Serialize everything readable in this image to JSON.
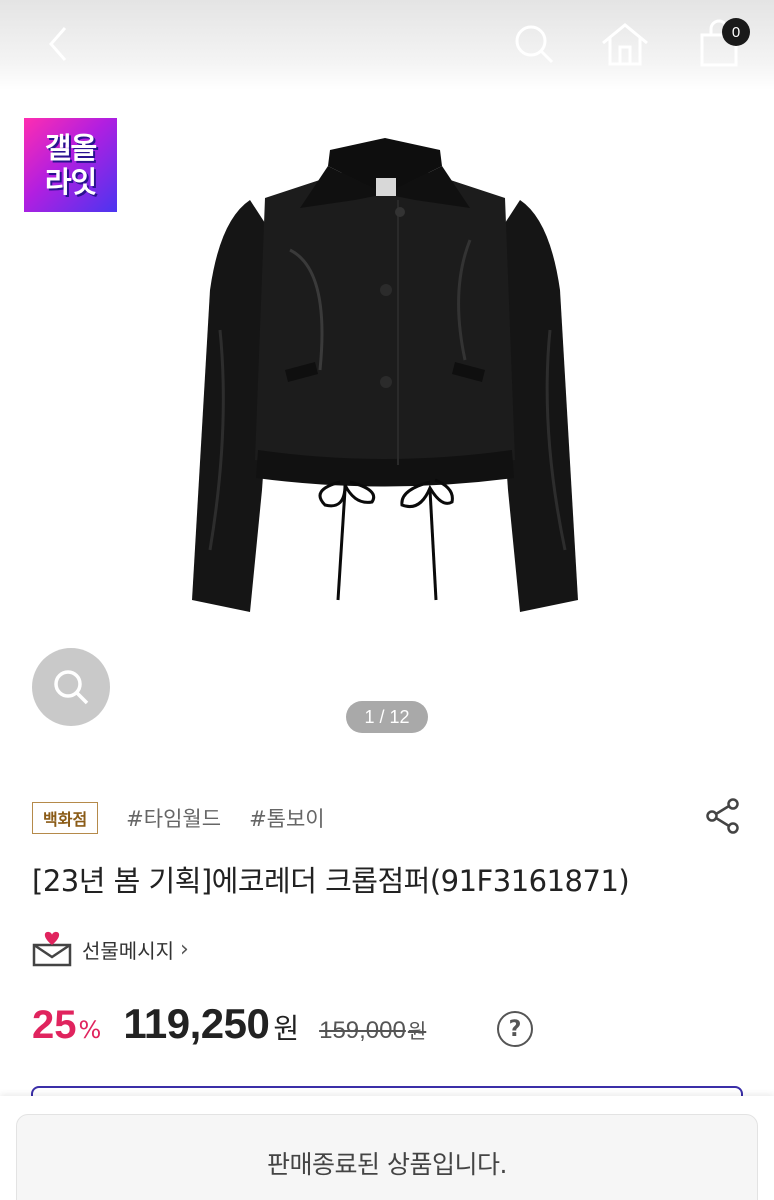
{
  "header": {
    "back_icon": "chevron-left-icon",
    "search_icon": "search-icon",
    "home_icon": "home-icon",
    "cart_icon": "shopping-bag-icon",
    "cart_count": "0"
  },
  "promo": {
    "line1": "갤올",
    "line2": "라잇"
  },
  "gallery": {
    "pager": "1 / 12",
    "zoom_icon": "zoom-icon"
  },
  "product": {
    "store_badge": "백화점",
    "tags": [
      "#타임월드",
      "#톰보이"
    ],
    "title": "[23년 봄 기획]에코레더 크롭점퍼(91F3161871)",
    "gift_label": "선물메시지",
    "gift_chevron": "›",
    "discount": "25",
    "discount_unit": "%",
    "sale_price": "119,250",
    "sale_unit": "원",
    "original_price": "159,000",
    "original_unit": "원",
    "help_label": "?"
  },
  "footer": {
    "status": "판매종료된 상품입니다."
  },
  "colors": {
    "discount": "#e0245e",
    "accent_purple": "#3b2fa8",
    "badge_border": "#b58a4a"
  }
}
